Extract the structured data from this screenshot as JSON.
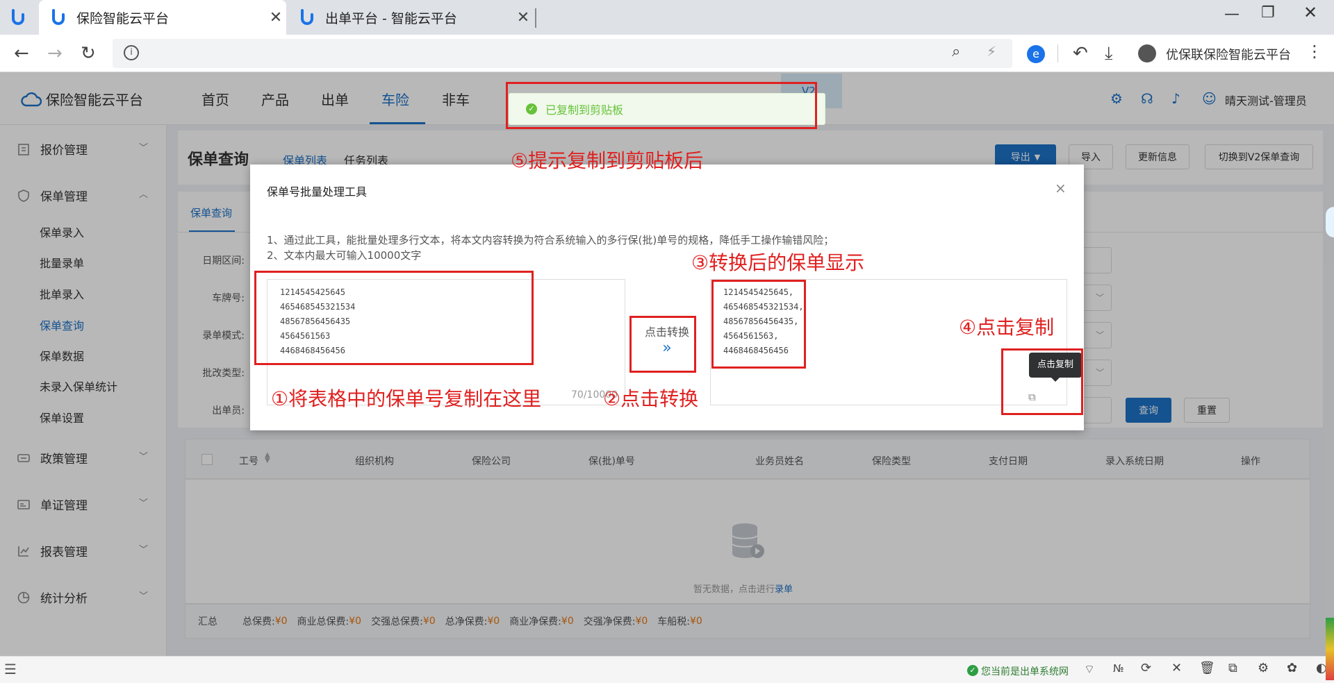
{
  "browser": {
    "tabs": [
      {
        "title": "保险智能云平台"
      },
      {
        "title": "出单平台 - 智能云平台"
      }
    ],
    "profile": "优保联保险智能云平台"
  },
  "app": {
    "logo": "保险智能云平台",
    "nav": [
      "首页",
      "产品",
      "出单",
      "车险",
      "非车"
    ],
    "user": "晴天测试-管理员",
    "version_badge": "V2"
  },
  "sidebar": {
    "groups": [
      {
        "label": "报价管理"
      },
      {
        "label": "保单管理",
        "items": [
          "保单录入",
          "批量录单",
          "批单录入",
          "保单查询",
          "保单数据",
          "未录入保单统计",
          "保单设置"
        ]
      },
      {
        "label": "政策管理"
      },
      {
        "label": "单证管理"
      },
      {
        "label": "报表管理"
      },
      {
        "label": "统计分析"
      }
    ]
  },
  "page": {
    "title": "保单查询",
    "tabs": [
      "保单列表",
      "任务列表"
    ],
    "subtab": "保单查询",
    "actions": [
      "导出",
      "导入",
      "更新信息",
      "切换到V2保单查询"
    ],
    "filters": [
      "日期区间:",
      "车牌号:",
      "录单模式:",
      "批改类型:",
      "出单员:"
    ],
    "query": "查询",
    "reset": "重置",
    "table_headers": [
      "工号",
      "组织机构",
      "保险公司",
      "保(批)单号",
      "业务员姓名",
      "保险类型",
      "支付日期",
      "录入系统日期",
      "操作"
    ],
    "empty_text": "暂无数据，点击进行",
    "empty_link": "录单",
    "summary": {
      "label": "汇总",
      "items": [
        {
          "k": "总保费:",
          "v": "¥0"
        },
        {
          "k": "商业总保费:",
          "v": "¥0"
        },
        {
          "k": "交强总保费:",
          "v": "¥0"
        },
        {
          "k": "总净保费:",
          "v": "¥0"
        },
        {
          "k": "商业净保费:",
          "v": "¥0"
        },
        {
          "k": "交强净保费:",
          "v": "¥0"
        },
        {
          "k": "车船税:",
          "v": "¥0"
        }
      ]
    }
  },
  "dialog": {
    "title": "保单号批量处理工具",
    "desc1": "1、通过此工具，能批量处理多行文本，将本文内容转换为符合系统输入的多行保(批)单号的规格，降低手工操作输错风险；",
    "desc2": "2、文本内最大可输入10000文字",
    "input_lines": [
      "1214545425645",
      "465468545321534",
      "48567856456435",
      "4564561563",
      "4468468456456"
    ],
    "counter": "70/10000",
    "convert_label": "点击转换",
    "output_lines": [
      "1214545425645,",
      "465468545321534,",
      "48567856456435,",
      "4564561563,",
      "4468468456456"
    ],
    "copy_tooltip": "点击复制"
  },
  "toast": "已复制到剪贴板",
  "annotations": {
    "a1": "①将表格中的保单号复制在这里",
    "a2": "②点击转换",
    "a3": "③转换后的保单显示",
    "a4": "④点击复制",
    "a5": "⑤提示复制到剪贴板后"
  },
  "status": {
    "text": "您当前是出单系统网"
  }
}
